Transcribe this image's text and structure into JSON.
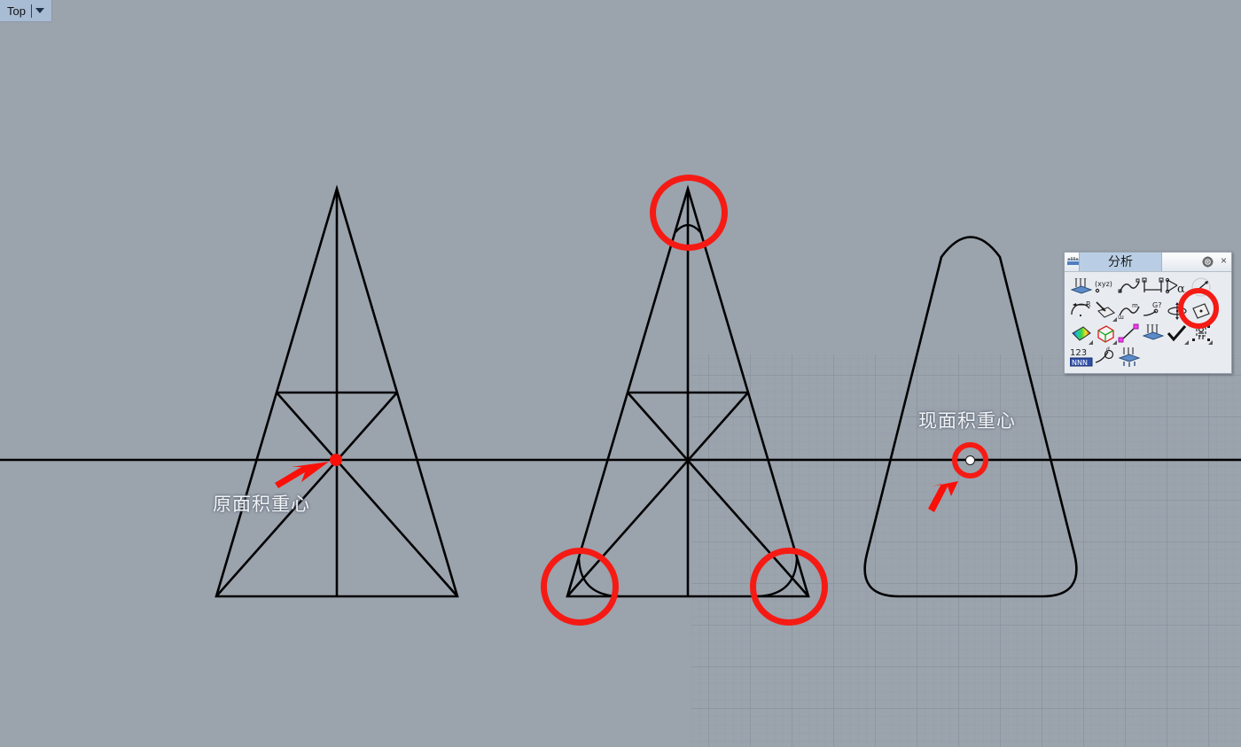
{
  "app": {
    "viewport_tab": {
      "label": "Top",
      "caret_icon": "chevron-down-icon"
    },
    "background_color": "#9ba3ad",
    "grid_color": "#8d96a1",
    "geometry_color": "#000000",
    "annotation_color": "#f51b14",
    "label_color": "#f2f4f7"
  },
  "panel": {
    "title": "分析",
    "tab_icon": "analysis-doc-icon",
    "gear_icon": "gear-icon",
    "close_icon": "close-icon",
    "close_label": "×",
    "tools": [
      {
        "name": "direction-analysis-icon",
        "row": 1,
        "col": 1
      },
      {
        "name": "point-xyz-coordinates-icon",
        "row": 1,
        "col": 2,
        "label": "(xyz)"
      },
      {
        "name": "curvature-graph-icon",
        "row": 1,
        "col": 3
      },
      {
        "name": "distance-measure-icon",
        "row": 1,
        "col": 4
      },
      {
        "name": "angle-measure-icon",
        "row": 1,
        "col": 5,
        "label": "α"
      },
      {
        "name": "length-measure-icon",
        "row": 1,
        "col": 6
      },
      {
        "name": "radius-measure-icon",
        "row": 2,
        "col": 1,
        "label": "R"
      },
      {
        "name": "surface-normal-icon",
        "row": 2,
        "col": 2
      },
      {
        "name": "curve-continuity-icon",
        "row": 2,
        "col": 3
      },
      {
        "name": "geometry-continuity-icon",
        "row": 2,
        "col": 4,
        "label": "G?"
      },
      {
        "name": "volume-centroid-icon",
        "row": 2,
        "col": 5
      },
      {
        "name": "area-centroid-icon",
        "row": 2,
        "col": 6,
        "highlighted": true
      },
      {
        "name": "zebra-surface-analysis-icon",
        "row": 3,
        "col": 1
      },
      {
        "name": "bounding-box-icon",
        "row": 3,
        "col": 2
      },
      {
        "name": "point-distance-icon",
        "row": 3,
        "col": 3
      },
      {
        "name": "draft-angle-analysis-icon",
        "row": 3,
        "col": 4
      },
      {
        "name": "check-objects-icon",
        "row": 3,
        "col": 5
      },
      {
        "name": "extract-points-icon",
        "row": 3,
        "col": 6
      },
      {
        "name": "numeric-list-icon",
        "row": 4,
        "col": 1,
        "label": "123"
      },
      {
        "name": "curvature-circle-icon",
        "row": 4,
        "col": 2
      },
      {
        "name": "curvature-analysis-icon",
        "row": 4,
        "col": 3
      }
    ],
    "highlight": {
      "target": "area-centroid-icon",
      "shape": "red-circle"
    }
  },
  "annotations": {
    "original_centroid_label": "原面积重心",
    "current_centroid_label": "现面积重心",
    "red_circles": [
      {
        "name": "apex-fillet-highlight",
        "target": "middle-triangle-apex"
      },
      {
        "name": "bottom-left-fillet-highlight",
        "target": "middle-triangle-bottom-left"
      },
      {
        "name": "bottom-right-fillet-highlight",
        "target": "middle-triangle-bottom-right"
      },
      {
        "name": "current-centroid-highlight",
        "target": "rounded-triangle-centroid"
      }
    ],
    "arrows": [
      {
        "name": "original-centroid-arrow",
        "points_to": "original-centroid-marker"
      },
      {
        "name": "current-centroid-arrow",
        "points_to": "current-centroid-marker"
      }
    ],
    "markers": [
      {
        "name": "original-centroid-marker",
        "style": "filled-red-dot"
      },
      {
        "name": "current-centroid-marker",
        "style": "white-dot-black-outline"
      }
    ]
  },
  "geometry": {
    "shapes": [
      {
        "name": "sharp-triangle",
        "description": "原始尖角三角形 with medians",
        "fillet": "none"
      },
      {
        "name": "small-fillet-triangle",
        "description": "三角形 with small corner fillets",
        "fillet": "small"
      },
      {
        "name": "rounded-triangle",
        "description": "三角形 with large corner fillets",
        "fillet": "large"
      }
    ],
    "construction_lines": [
      "median-left",
      "median-right",
      "median-vertical",
      "midline-left",
      "midline-right"
    ],
    "world_axis": {
      "name": "world-x-axis",
      "orientation": "horizontal"
    }
  }
}
